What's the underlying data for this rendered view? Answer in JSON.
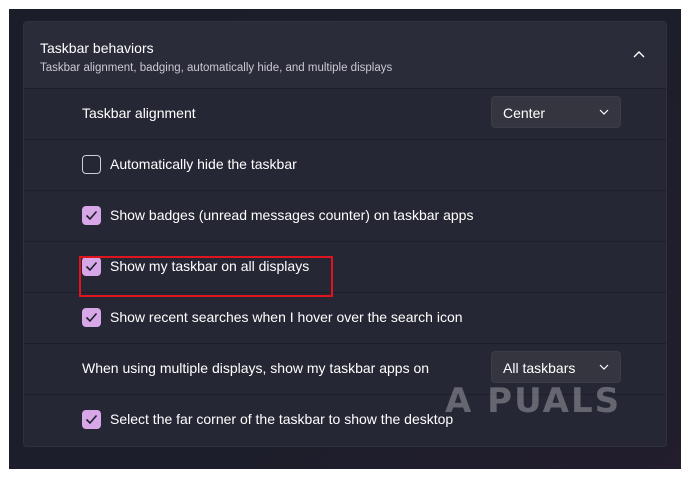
{
  "section": {
    "title": "Taskbar behaviors",
    "subtitle": "Taskbar alignment, badging, automatically hide, and multiple displays",
    "expanded": true
  },
  "rows": [
    {
      "label": "Taskbar alignment",
      "control": "dropdown",
      "value": "Center"
    },
    {
      "label": "Automatically hide the taskbar",
      "control": "checkbox",
      "checked": false
    },
    {
      "label": "Show badges (unread messages counter) on taskbar apps",
      "control": "checkbox",
      "checked": true
    },
    {
      "label": "Show my taskbar on all displays",
      "control": "checkbox",
      "checked": true,
      "highlighted": true
    },
    {
      "label": "Show recent searches when I hover over the search icon",
      "control": "checkbox",
      "checked": true
    },
    {
      "label": "When using multiple displays, show my taskbar apps on",
      "control": "dropdown",
      "value": "All taskbars"
    },
    {
      "label": "Select the far corner of the taskbar to show the desktop",
      "control": "checkbox",
      "checked": true
    }
  ],
  "watermark": "A  PUALS",
  "colors": {
    "accent": "#d7a7e8",
    "highlight_border": "#e0141f",
    "card_background": "#262734",
    "page_background": "#1c1d2a"
  },
  "icons": {
    "collapse": "chevron-up-icon",
    "dropdown": "chevron-down-icon",
    "check": "checkmark-icon"
  }
}
